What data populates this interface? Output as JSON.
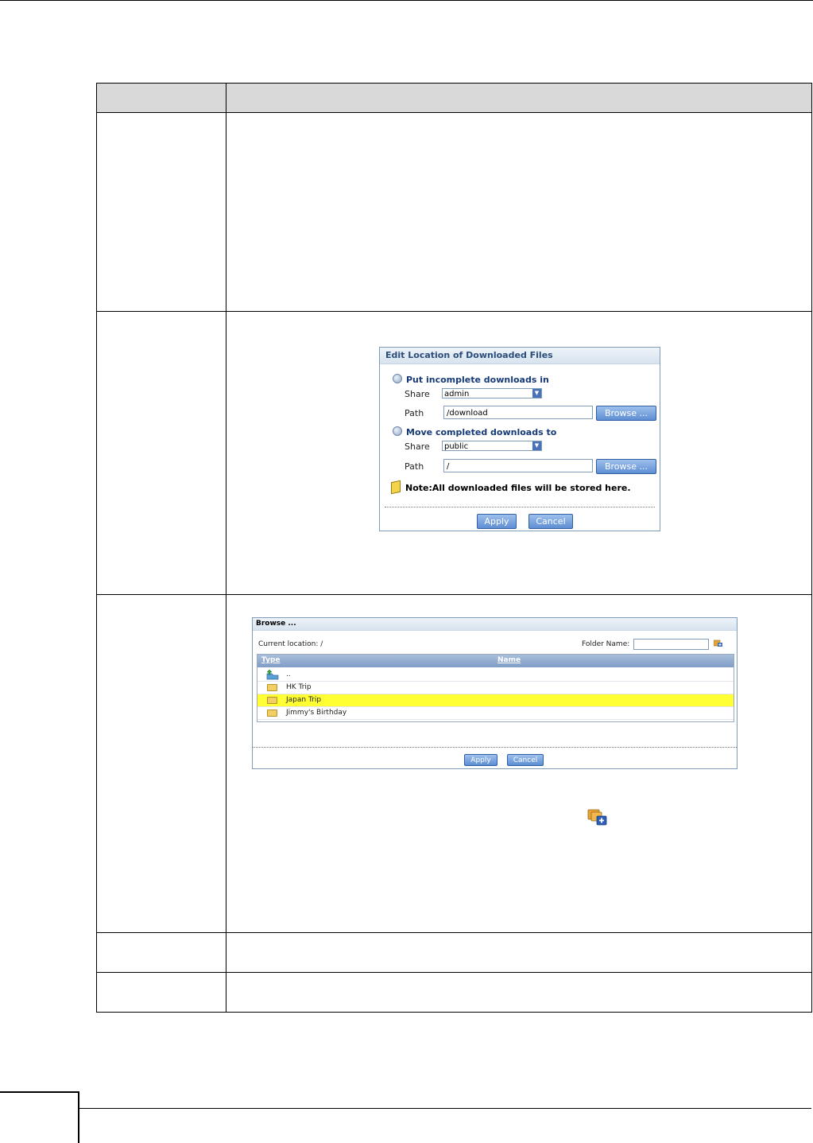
{
  "edit_location_dialog": {
    "title": "Edit Location of Downloaded Files",
    "incomplete_label": "Put incomplete downloads in",
    "share_label": "Share",
    "path_label": "Path",
    "incomplete_share": "admin",
    "incomplete_path": "/download",
    "completed_label": "Move completed downloads to",
    "completed_share": "public",
    "completed_path": "/",
    "browse_label": "Browse ...",
    "note": "Note:All downloaded files will be stored here.",
    "apply_label": "Apply",
    "cancel_label": "Cancel"
  },
  "browse_dialog": {
    "title": "Browse ...",
    "current_location": "Current location: /",
    "folder_name_label": "Folder Name:",
    "folder_name_value": "",
    "columns": [
      "Type",
      "Name"
    ],
    "rows": [
      {
        "name": "..",
        "icon": "up-folder-icon",
        "selected": false
      },
      {
        "name": "HK Trip",
        "icon": "folder-icon",
        "selected": false
      },
      {
        "name": "Japan Trip",
        "icon": "folder-icon",
        "selected": true
      },
      {
        "name": "Jimmy's Birthday",
        "icon": "folder-icon",
        "selected": false
      }
    ],
    "apply_label": "Apply",
    "cancel_label": "Cancel"
  },
  "colors": {
    "header_bg": "#d9d9d9",
    "selected_row": "#ffff33",
    "dialog_title": "#2b4d7a",
    "button": "#5e8ed3"
  }
}
